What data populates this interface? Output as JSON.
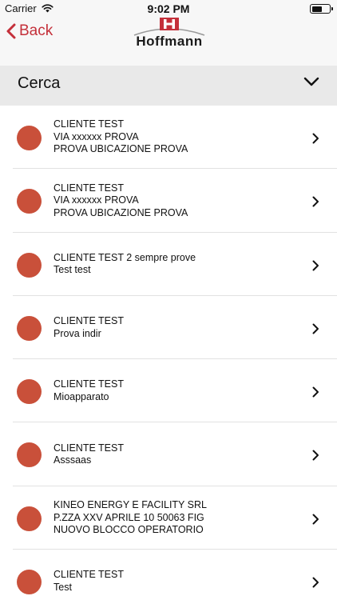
{
  "status_bar": {
    "carrier": "Carrier",
    "time": "9:02 PM"
  },
  "nav": {
    "back_label": "Back",
    "logo_text": "Hoffmann"
  },
  "search": {
    "label": "Cerca"
  },
  "colors": {
    "accent": "#c4303a",
    "status_dot": "#c9503a"
  },
  "items": [
    {
      "lines": [
        "CLIENTE TEST",
        "VIA xxxxxx PROVA",
        "PROVA UBICAZIONE PROVA"
      ]
    },
    {
      "lines": [
        "CLIENTE TEST",
        "VIA xxxxxx PROVA",
        "PROVA UBICAZIONE PROVA"
      ]
    },
    {
      "lines": [
        "CLIENTE TEST 2 sempre prove",
        "Test test"
      ]
    },
    {
      "lines": [
        "CLIENTE TEST",
        "Prova indir"
      ]
    },
    {
      "lines": [
        "CLIENTE TEST",
        "Mioapparato"
      ]
    },
    {
      "lines": [
        "CLIENTE TEST",
        "Asssaas"
      ]
    },
    {
      "lines": [
        "KINEO ENERGY E FACILITY SRL",
        "P.ZZA XXV APRILE 10 50063 FIG",
        "NUOVO BLOCCO OPERATORIO"
      ]
    },
    {
      "lines": [
        "CLIENTE TEST",
        "Test"
      ]
    }
  ]
}
